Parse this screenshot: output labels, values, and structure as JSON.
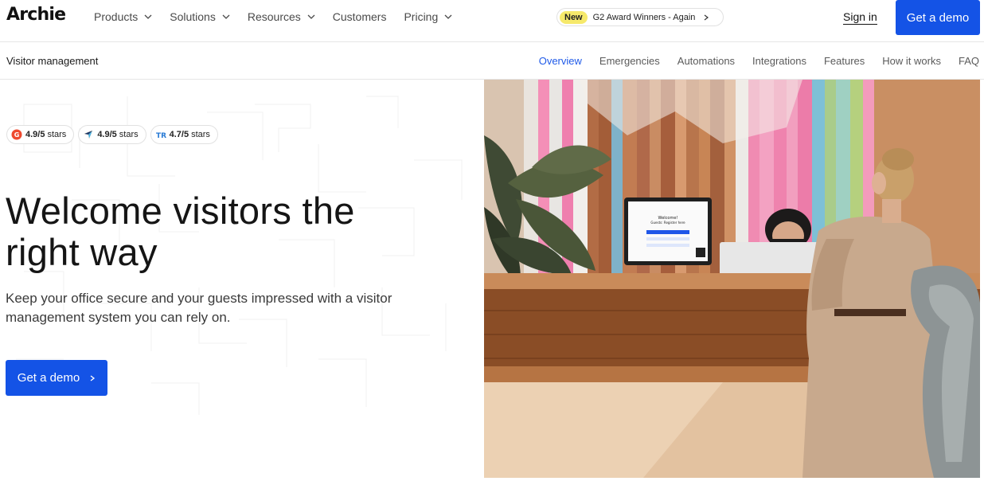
{
  "brand": {
    "name": "Archie"
  },
  "nav": {
    "items": [
      {
        "label": "Products",
        "has_dropdown": true
      },
      {
        "label": "Solutions",
        "has_dropdown": true
      },
      {
        "label": "Resources",
        "has_dropdown": true
      },
      {
        "label": "Customers",
        "has_dropdown": false
      },
      {
        "label": "Pricing",
        "has_dropdown": true
      }
    ],
    "award": {
      "badge": "New",
      "text": "G2 Award Winners - Again",
      "icon": "chevron-right-icon"
    },
    "signin_label": "Sign in",
    "demo_label": "Get a demo"
  },
  "subnav": {
    "title": "Visitor management",
    "links": [
      "Overview",
      "Emergencies",
      "Automations",
      "Integrations",
      "Features",
      "How it works",
      "FAQ"
    ],
    "active": "Overview"
  },
  "hero": {
    "ratings": [
      {
        "icon": "g2-icon",
        "score": "4.9/5",
        "suffix": "stars"
      },
      {
        "icon": "capterra-icon",
        "score": "4.9/5",
        "suffix": "stars"
      },
      {
        "icon": "trustradius-icon",
        "score": "4.7/5",
        "suffix": "stars"
      }
    ],
    "headline_line1": "Welcome visitors the",
    "headline_line2": "right way",
    "subtext_line1": "Keep your office secure and your guests impressed with a visitor",
    "subtext_line2": "management system you can rely on.",
    "cta_label": "Get a demo",
    "image": {
      "description": "Office reception desk with a visitor and receptionist",
      "tablet_title": "Welcome!",
      "tablet_subtitle": "Guests: Register here"
    }
  },
  "colors": {
    "primary": "#1453e6",
    "active_link": "#1f5ae8",
    "badge_yellow": "#f6e96b",
    "g2_red": "#ee4a2f"
  }
}
